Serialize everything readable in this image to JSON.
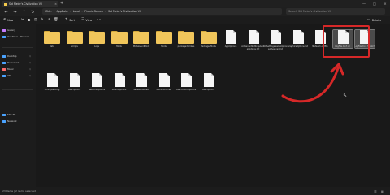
{
  "window": {
    "tab_title": "Sid Meier's Civilization VII",
    "tab_close": "×",
    "new_tab": "+",
    "minimize": "—",
    "maximize": "□",
    "close": "×"
  },
  "nav": {
    "back": "←",
    "forward": "→",
    "up": "↑",
    "refresh": "↻",
    "breadcrumb": [
      "Cktn",
      "AppData",
      "Local",
      "Firaxis Games",
      "Sid Meier's Civilization VII"
    ],
    "search_placeholder": "Search Sid Meier's Civilization VII"
  },
  "commands": {
    "new": "New",
    "sort": "Sort",
    "view": "View",
    "details": "Details"
  },
  "sidebar": {
    "top": [
      {
        "label": "Gallery",
        "color": "#c77dff"
      },
      {
        "label": "OneDrive - Persona",
        "color": "#4aa3ff"
      }
    ],
    "pinned": [
      {
        "label": "Desktop",
        "color": "#4aa3ff"
      },
      {
        "label": "Downloads",
        "color": "#4aa3ff"
      },
      {
        "label": "Music",
        "color": "#ff6b6b"
      },
      {
        "label": "3D",
        "color": "#4aa3ff"
      }
    ],
    "bottom": [
      {
        "label": "This PC",
        "color": "#4aa3ff"
      },
      {
        "label": "Network",
        "color": "#4aa3ff"
      }
    ]
  },
  "files": [
    {
      "name": "data",
      "type": "folder"
    },
    {
      "name": "Scripts",
      "type": "folder"
    },
    {
      "name": "Logs",
      "type": "folder"
    },
    {
      "name": "Mods",
      "type": "folder"
    },
    {
      "name": "ModelsAndMods",
      "type": "folder"
    },
    {
      "name": "Mods",
      "type": "folder"
    },
    {
      "name": "packagedfolders",
      "type": "folder"
    },
    {
      "name": "PackagedMods",
      "type": "folder"
    },
    {
      "name": "AppOptions",
      "type": "doc"
    },
    {
      "name": "AdvancedSettingsGameOptions.txt",
      "type": "doc"
    },
    {
      "name": "CivSettingsGameOptionsAdvanced.txt",
      "type": "doc"
    },
    {
      "name": "GraphicsOptions.txt",
      "type": "doc"
    },
    {
      "name": "Network.optfile",
      "type": "doc"
    },
    {
      "name": "LogFile.Civ7.xt",
      "type": "doc",
      "selected": true
    },
    {
      "name": "LogFile.Civ7.Scratch",
      "type": "doc",
      "selected": true
    },
    {
      "name": "ConfigData.log",
      "type": "doc"
    },
    {
      "name": "UserOptions",
      "type": "doc"
    },
    {
      "name": "NetworkOptions",
      "type": "doc"
    },
    {
      "name": "SoundOptions",
      "type": "doc"
    },
    {
      "name": "SaveGameData",
      "type": "doc"
    },
    {
      "name": "SoundVolumes",
      "type": "doc"
    },
    {
      "name": "UserControlOptions",
      "type": "doc"
    },
    {
      "name": "UserOptions",
      "type": "doc"
    }
  ],
  "status": {
    "text": "23 items  |  2 items selected"
  },
  "colors": {
    "highlight": "#d62828",
    "folder": "#f1c65b"
  }
}
